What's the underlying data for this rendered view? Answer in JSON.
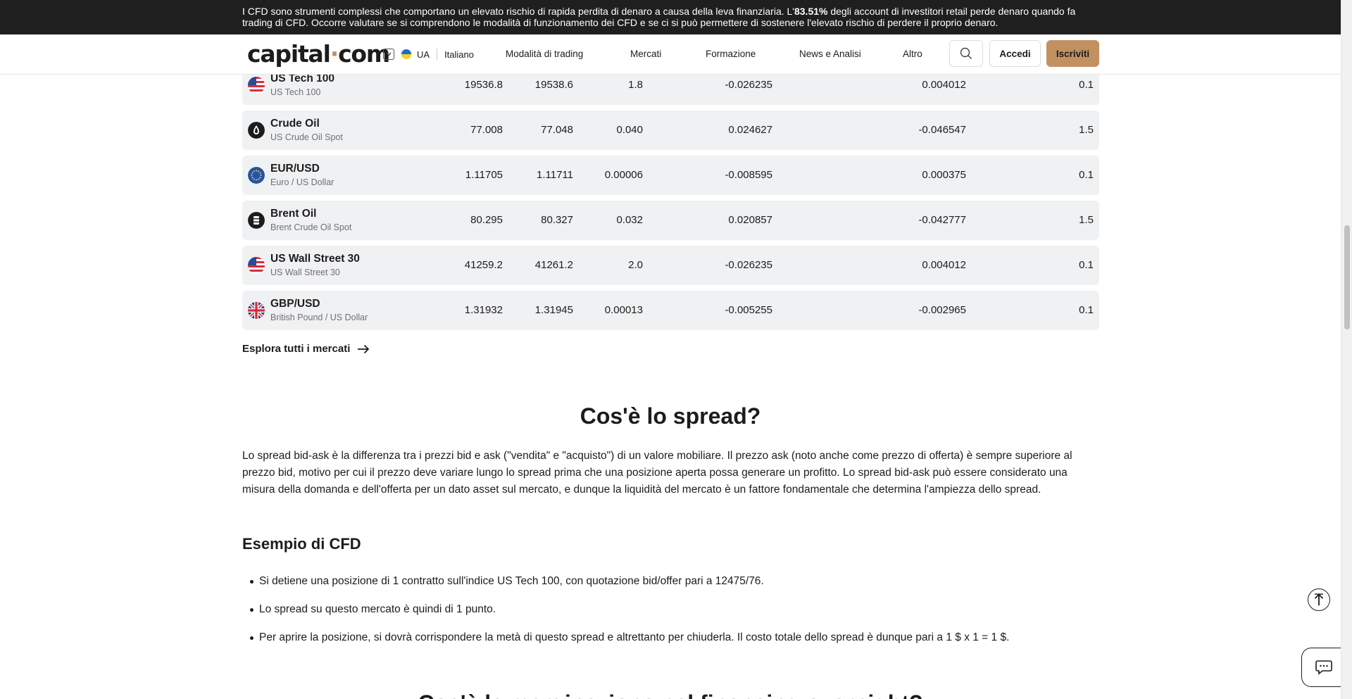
{
  "risk_banner": {
    "text_before": "I CFD sono strumenti complessi che comportano un elevato rischio di rapida perdita di denaro a causa della leva finanziaria. L'",
    "percentage": "83.51%",
    "text_after": " degli account di investitori retail perde denaro quando fa trading di CFD. Occorre valutare se si comprendono le modalità di funzionamento dei CFD e se ci si può permettere di sostenere l'elevato rischio di perdere il proprio denaro."
  },
  "header": {
    "logo_main": "capital",
    "logo_dot": "·",
    "logo_end": "com",
    "region": "UA",
    "language": "Italiano",
    "nav": [
      "Modalità di trading",
      "Mercati",
      "Formazione",
      "News e Analisi",
      "Altro"
    ],
    "login_label": "Accedi",
    "signup_label": "Iscriviti"
  },
  "markets": [
    {
      "name": "US Tech 100",
      "sub": "US Tech 100",
      "icon": "us-flag-icon",
      "sell": "19536.8",
      "buy": "19538.6",
      "spread": "1.8",
      "long_swap": "-0.026235",
      "short_swap": "0.004012",
      "margin": "0.1"
    },
    {
      "name": "Crude Oil",
      "sub": "US Crude Oil Spot",
      "icon": "oil-drop-icon",
      "sell": "77.008",
      "buy": "77.048",
      "spread": "0.040",
      "long_swap": "0.024627",
      "short_swap": "-0.046547",
      "margin": "1.5"
    },
    {
      "name": "EUR/USD",
      "sub": "Euro / US Dollar",
      "icon": "eu-flag-icon",
      "sell": "1.11705",
      "buy": "1.11711",
      "spread": "0.00006",
      "long_swap": "-0.008595",
      "short_swap": "0.000375",
      "margin": "0.1"
    },
    {
      "name": "Brent Oil",
      "sub": "Brent Crude Oil Spot",
      "icon": "oil-barrel-icon",
      "sell": "80.295",
      "buy": "80.327",
      "spread": "0.032",
      "long_swap": "0.020857",
      "short_swap": "-0.042777",
      "margin": "1.5"
    },
    {
      "name": "US Wall Street 30",
      "sub": "US Wall Street 30",
      "icon": "us-flag-icon",
      "sell": "41259.2",
      "buy": "41261.2",
      "spread": "2.0",
      "long_swap": "-0.026235",
      "short_swap": "0.004012",
      "margin": "0.1"
    },
    {
      "name": "GBP/USD",
      "sub": "British Pound / US Dollar",
      "icon": "uk-flag-icon",
      "sell": "1.31932",
      "buy": "1.31945",
      "spread": "0.00013",
      "long_swap": "-0.005255",
      "short_swap": "-0.002965",
      "margin": "0.1"
    }
  ],
  "explore_label": "Esplora tutti i mercati",
  "article": {
    "title": "Cos'è lo spread?",
    "paragraph": "Lo spread bid-ask è la differenza tra i prezzi bid e ask (\"vendita\" e \"acquisto\") di un valore mobiliare. Il prezzo ask (noto anche come prezzo di offerta) è sempre superiore al prezzo bid, motivo per cui il prezzo deve variare lungo lo spread prima che una posizione aperta possa generare un profitto. Lo spread bid-ask può essere considerato una misura della domanda e dell'offerta per un dato asset sul mercato, e dunque la liquidità del mercato è un fattore fondamentale che determina l'ampiezza dello spread.",
    "example_title": "Esempio di CFD",
    "bullets": [
      "Si detiene una posizione di 1 contratto sull'indice US Tech 100, con quotazione bid/offer pari a 12475/76.",
      "Lo spread su questo mercato è quindi di 1 punto.",
      "Per aprire la posizione, si dovrà corrispondere la metà di questo spread e altrettanto per chiuderla. Il costo totale dello spread è dunque pari a 1 $ x 1 = 1 $."
    ],
    "next_title": "Cos'è la marginazione nel financing overnight?"
  },
  "colors": {
    "accent": "#c39161",
    "banner_bg": "#1f1f1f",
    "row_bg": "#f0f1f3"
  }
}
